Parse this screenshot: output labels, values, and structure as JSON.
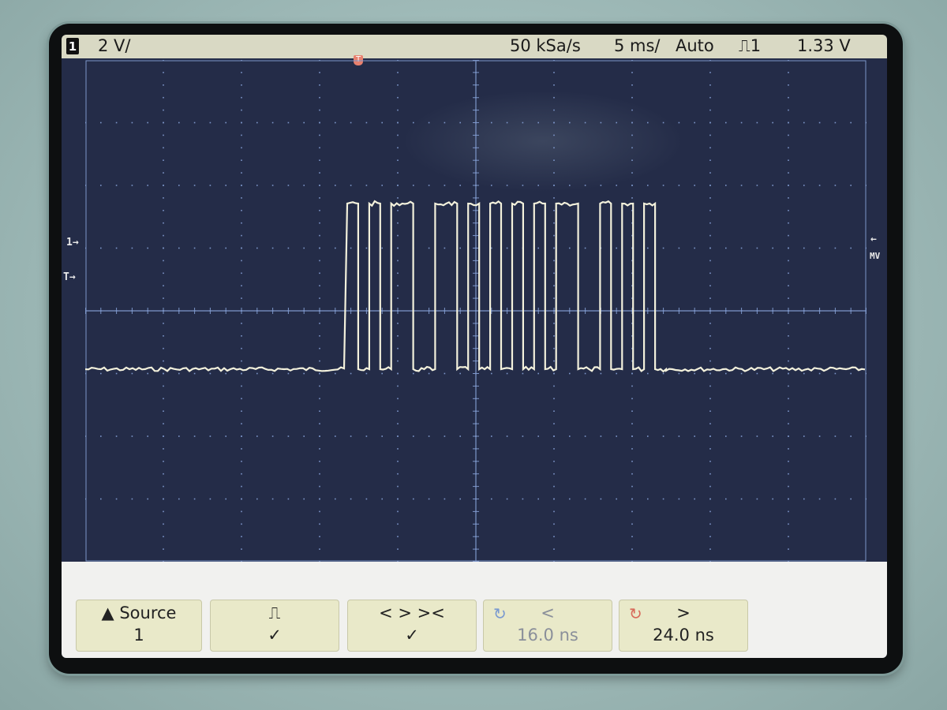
{
  "status_bar": {
    "channel_badge": "1",
    "volts_per_div": "2 V/",
    "sample_rate": "50 kSa/s",
    "time_per_div": "5 ms/",
    "trigger_mode": "Auto",
    "trigger_edge": "⎍1",
    "trigger_level": "1.33 V"
  },
  "markers": {
    "trigger_top": "T",
    "ground_ch1": "1→",
    "trigger_level_left": "T→",
    "trigger_level_right": "←",
    "right_label": "MV"
  },
  "softkeys": [
    {
      "line1": "▲ Source",
      "line2": "1"
    },
    {
      "line1": "⎍",
      "line2": "✓"
    },
    {
      "line1": "<  >  ><",
      "line2": "✓"
    },
    {
      "line1": "<",
      "line2": "16.0 ns",
      "icon": "cw-knob-icon"
    },
    {
      "line1": ">",
      "line2": "24.0 ns",
      "icon": "ccw-knob-icon"
    }
  ],
  "colors": {
    "screen": "#242c48",
    "trace": "#f3f1dc",
    "grid": "#7d96c9",
    "status_bar": "#d9d9c4",
    "softkey": "#e9e9c9"
  },
  "waveform_bits": [
    1,
    0,
    1,
    0,
    1,
    1,
    0,
    0,
    1,
    1,
    0,
    1,
    0,
    1,
    0,
    1,
    0,
    1,
    0,
    1,
    1,
    0,
    0,
    1,
    0,
    1,
    0,
    1,
    0
  ],
  "noise_level": 0.25
}
